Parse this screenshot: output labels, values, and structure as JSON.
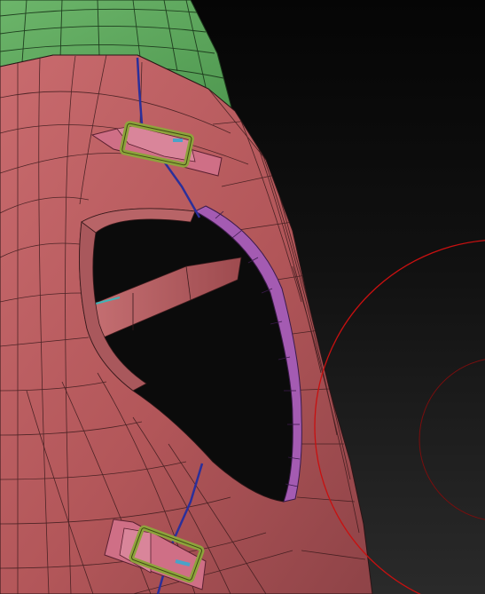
{
  "scene": {
    "kind": "3d-sculpt-viewport",
    "colors": {
      "background_top": "#050505",
      "background_bottom": "#2c2c2c",
      "hood_fill": "#b55a5e",
      "hood_fill_light": "#c86a6c",
      "hood_fill_dark": "#8e4347",
      "cap_fill": "#5fa85e",
      "wire": "#2a1416",
      "seam": "#3a3aa0",
      "rim": "#a45bb2",
      "strap": "#cf6f86",
      "buckle": "#8ea33c",
      "brush_outer": "#c81010",
      "brush_inner": "#7a0e0e"
    },
    "elements": {
      "green_cap": "green-cap-mesh",
      "hood": "hood-mesh",
      "opening": "hood-opening",
      "rim_band": "purple-rim-band",
      "buckle_upper": "buckle-strap-upper",
      "buckle_lower": "buckle-strap-lower",
      "brush_cursor": "brush-cursor"
    }
  }
}
